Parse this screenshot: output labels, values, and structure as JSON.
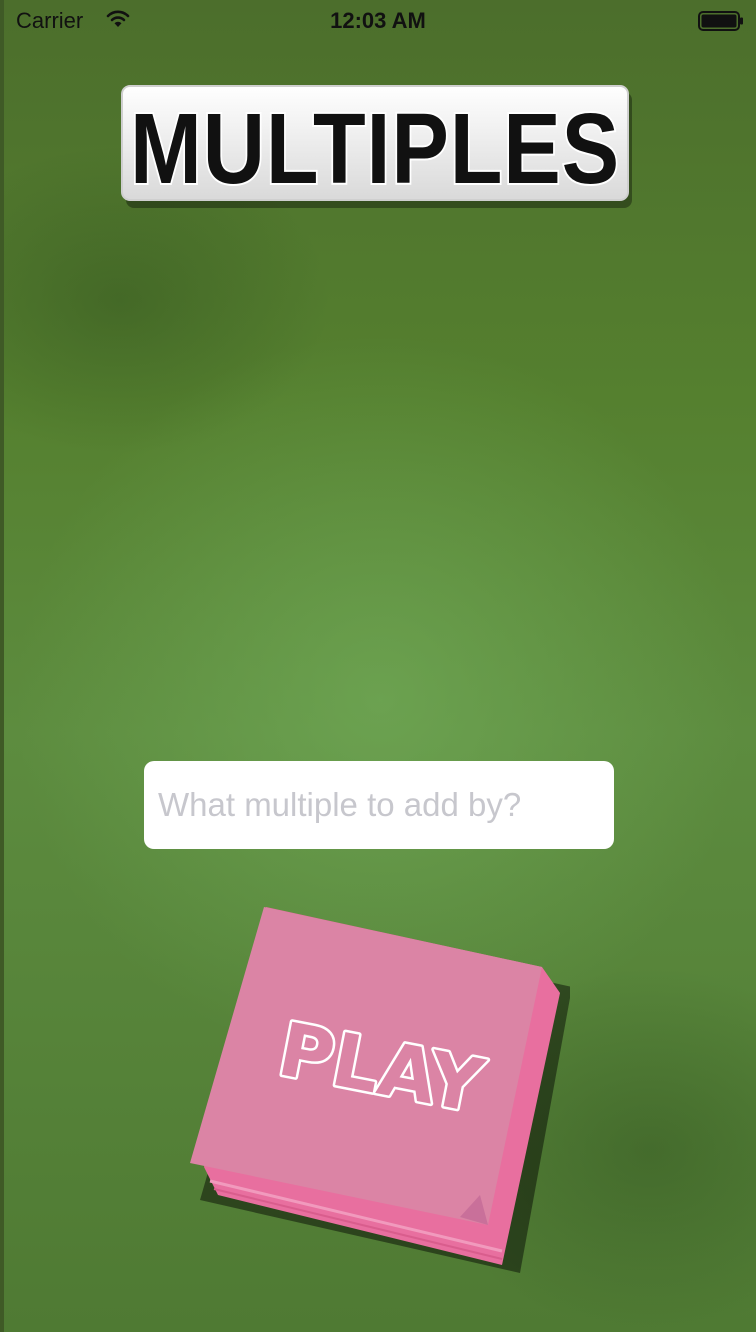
{
  "status_bar": {
    "carrier": "Carrier",
    "time": "12:03 AM",
    "wifi_icon": "wifi-icon",
    "battery_icon": "battery-icon"
  },
  "title": {
    "text": "MULTIPLES"
  },
  "input": {
    "placeholder": "What multiple to add by?",
    "value": ""
  },
  "play_button": {
    "label": "PLAY"
  },
  "colors": {
    "background": "#55802f",
    "note_pink": "#db84a5",
    "note_edge": "#e86f9f"
  }
}
